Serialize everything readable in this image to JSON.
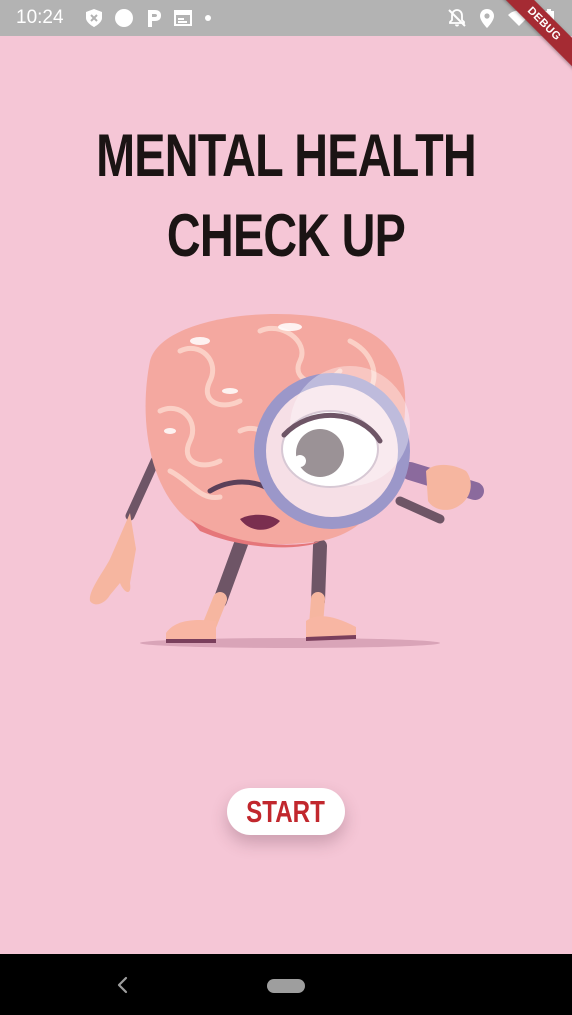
{
  "status_bar": {
    "time": "10:24",
    "left_icons": [
      "shield-x-icon",
      "circle-icon",
      "parking-icon",
      "calendar-icon",
      "dot-icon"
    ],
    "right_icons": [
      "bell-off-icon",
      "location-icon",
      "wifi-icon",
      "battery-icon"
    ]
  },
  "debug_banner": "DEBUG",
  "main": {
    "title_line1": "MENTAL HEALTH",
    "title_line2": "CHECK UP",
    "illustration": "brain-with-magnifying-glass",
    "start_label": "START"
  },
  "colors": {
    "background": "#f5c6d6",
    "title": "#1b1414",
    "start_text": "#c1272d",
    "button_bg": "#ffffff"
  },
  "nav_bar": {
    "buttons": [
      "back-button",
      "home-button"
    ]
  }
}
